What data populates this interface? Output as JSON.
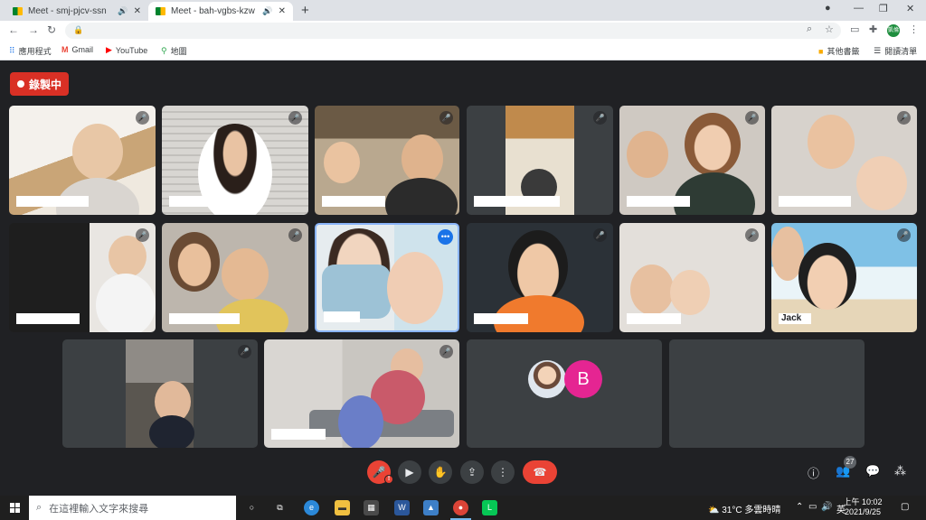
{
  "browser": {
    "tabs": [
      {
        "title": "Meet - smj-pjcv-ssn",
        "active": false
      },
      {
        "title": "Meet - bah-vgbs-kzw",
        "active": true
      }
    ],
    "profile_initials": "凱倫",
    "bookmarks": [
      {
        "label": "應用程式",
        "icon": "apps-grid-icon"
      },
      {
        "label": "Gmail",
        "icon": "gmail-icon"
      },
      {
        "label": "YouTube",
        "icon": "youtube-icon"
      },
      {
        "label": "地圖",
        "icon": "maps-pin-icon"
      }
    ],
    "bookmarks_right": [
      {
        "label": "其他書籤",
        "icon": "folder-icon"
      },
      {
        "label": "閱讀清單",
        "icon": "reading-list-icon"
      }
    ]
  },
  "meet": {
    "recording_label": "錄製中",
    "tiles": [
      {
        "name": "",
        "muted": true
      },
      {
        "name": "",
        "muted": true
      },
      {
        "name": "",
        "muted": true
      },
      {
        "name": "",
        "muted": true
      },
      {
        "name": "",
        "muted": true
      },
      {
        "name": "",
        "muted": true
      },
      {
        "name": "",
        "muted": true
      },
      {
        "name": "",
        "muted": true
      },
      {
        "name": "",
        "muted": false,
        "speaking": true
      },
      {
        "name": "",
        "muted": true
      },
      {
        "name": "",
        "muted": true
      },
      {
        "name": "Jack",
        "muted": true
      },
      {
        "name": "",
        "muted": true
      },
      {
        "name": "",
        "muted": true
      },
      {
        "name": "",
        "muted": false,
        "avatar_letter": "B"
      },
      {
        "name": "",
        "muted": false
      }
    ],
    "participant_count": "27"
  },
  "taskbar": {
    "search_placeholder": "在這裡輸入文字來搜尋",
    "weather": "31°C 多雲時晴",
    "ime": "英",
    "time": "上午 10:02",
    "date": "2021/9/25"
  },
  "colors": {
    "meet_bg": "#202124",
    "recording_red": "#d93025",
    "speaker_border": "#8ab4f8",
    "avatar_pink": "#e52592"
  }
}
